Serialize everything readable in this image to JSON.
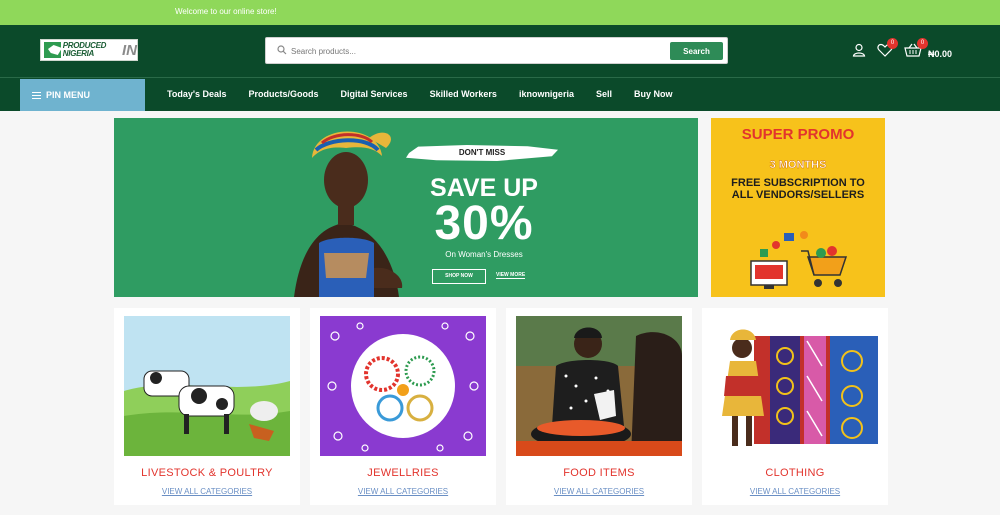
{
  "topbar": {
    "welcome": "Welcome to our online store!"
  },
  "header": {
    "logo_text": "PRODUCED NIGERIA",
    "logo_suffix": "IN",
    "search_placeholder": "Search products...",
    "search_button": "Search",
    "wishlist_count": "0",
    "cart_count": "0",
    "cart_total": "₦0.00"
  },
  "nav": {
    "pin_menu": "PIN MENU",
    "links": [
      "Today's Deals",
      "Products/Goods",
      "Digital Services",
      "Skilled Workers",
      "iknownigeria",
      "Sell",
      "Buy Now"
    ]
  },
  "hero": {
    "badge": "DON'T MISS",
    "headline": "SAVE UP",
    "percent": "30%",
    "subtitle": "On Woman's Dresses",
    "shop_now": "SHOP NOW",
    "view_more": "VIEW MORE"
  },
  "promo": {
    "title": "SUPER PROMO",
    "duration": "3 MONTHS",
    "text": "FREE SUBSCRIPTION TO ALL VENDORS/SELLERS"
  },
  "categories": [
    {
      "name": "LIVESTOCK & POULTRY",
      "link": "VIEW ALL CATEGORIES"
    },
    {
      "name": "JEWELLRIES",
      "link": "VIEW ALL CATEGORIES"
    },
    {
      "name": "FOOD ITEMS",
      "link": "VIEW ALL CATEGORIES"
    },
    {
      "name": "CLOTHING",
      "link": "VIEW ALL CATEGORIES"
    }
  ],
  "colors": {
    "topbar": "#8fd85a",
    "header": "#0b4a2a",
    "pin_menu": "#6fb3cf",
    "hero": "#2f9c62",
    "promo": "#f7c21b",
    "accent_red": "#e2342d"
  }
}
